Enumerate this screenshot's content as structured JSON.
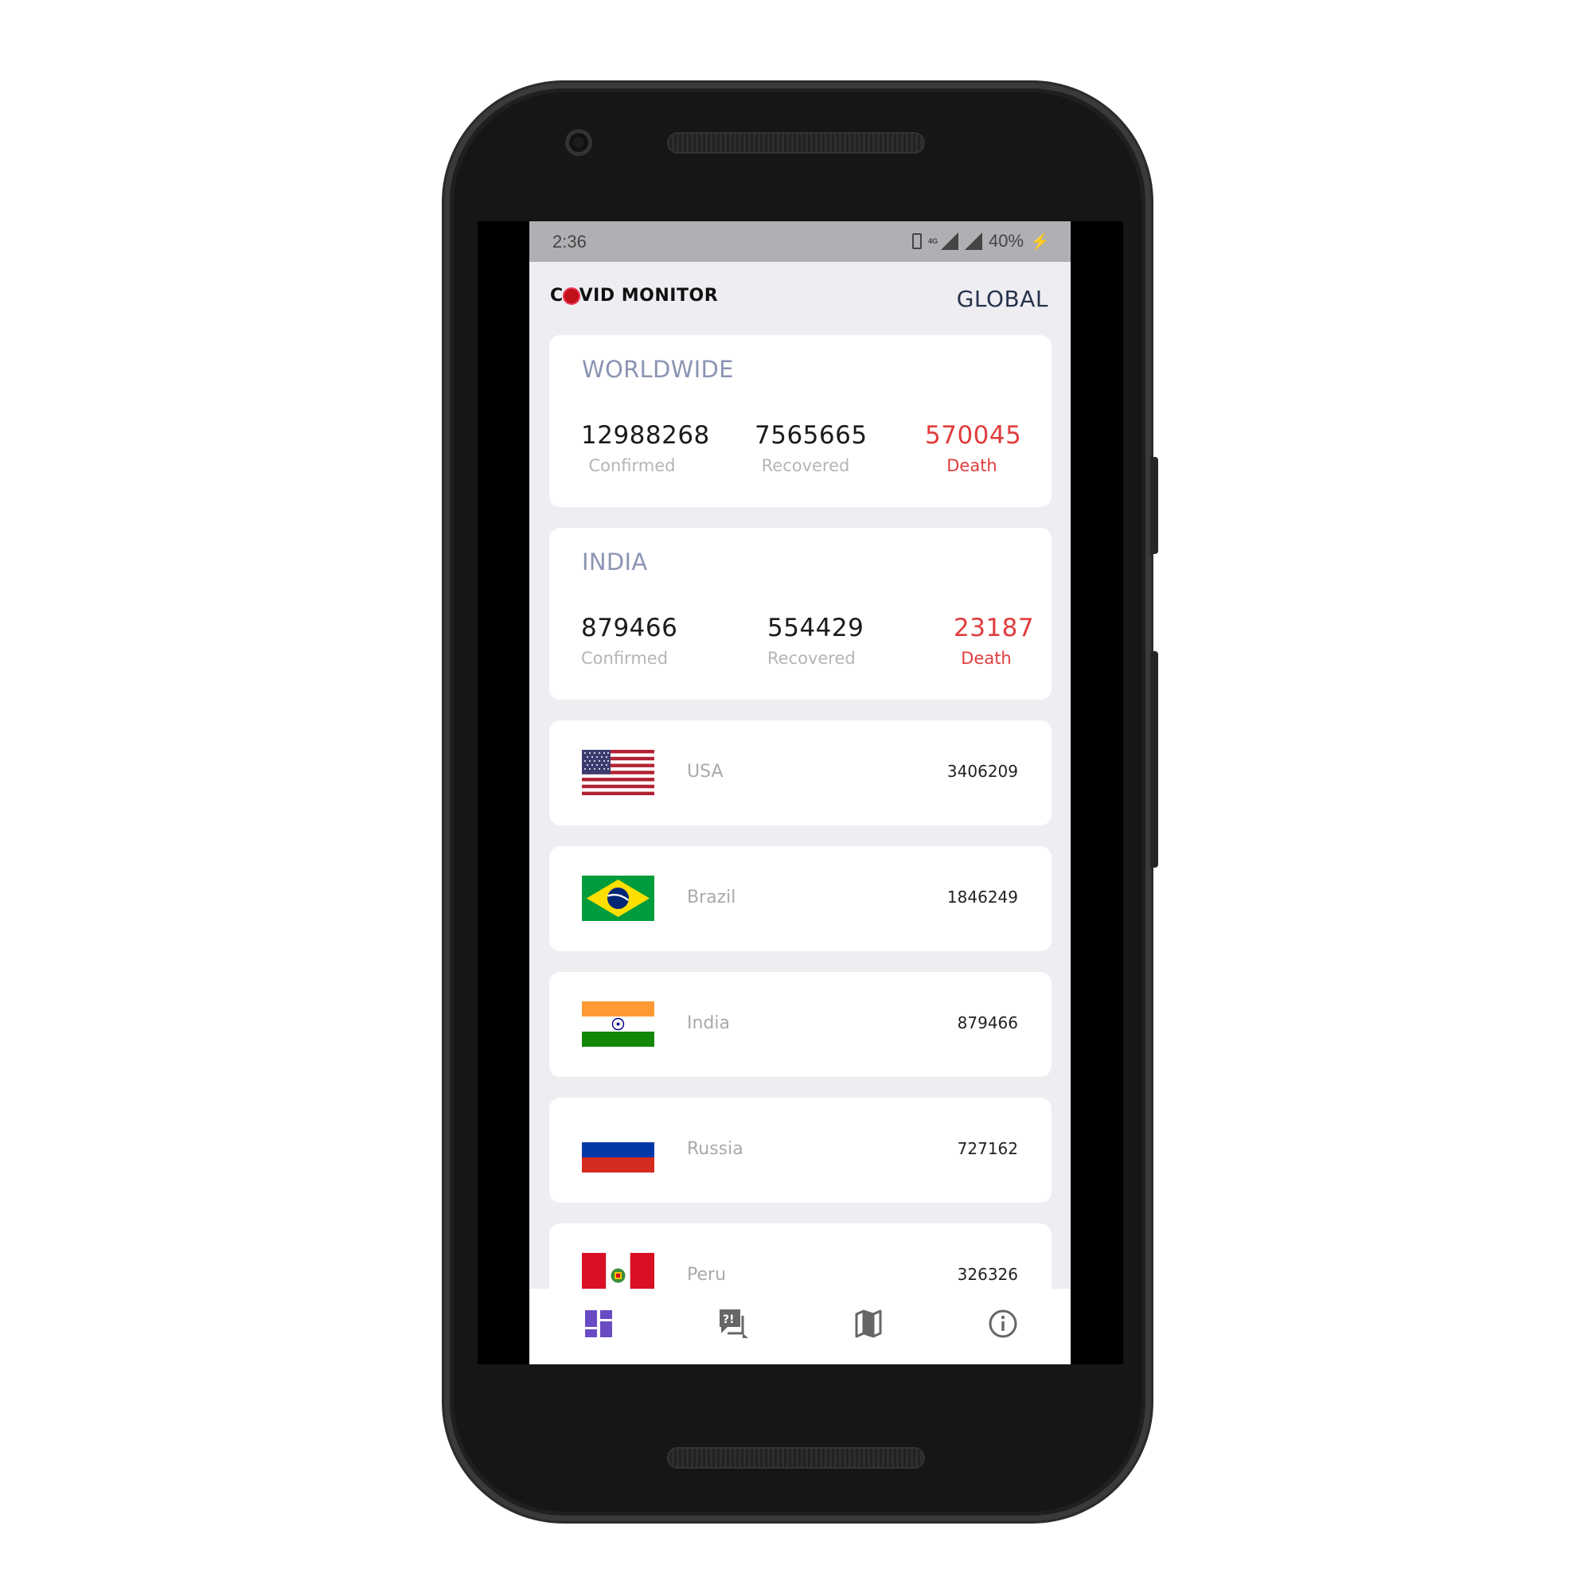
{
  "status_bar": {
    "time": "2:36",
    "network": "4G",
    "battery": "40%"
  },
  "header": {
    "logo_text_start": "C",
    "logo_text_end": "VID MONITOR",
    "title": "GLOBAL"
  },
  "worldwide": {
    "title": "WORLDWIDE",
    "confirmed": "12988268",
    "confirmed_label": "Confirmed",
    "recovered": "7565665",
    "recovered_label": "Recovered",
    "death": "570045",
    "death_label": "Death"
  },
  "india_summary": {
    "title": "INDIA",
    "confirmed": "879466",
    "confirmed_label": "Confirmed",
    "recovered": "554429",
    "recovered_label": "Recovered",
    "death": "23187",
    "death_label": "Death"
  },
  "countries": [
    {
      "name": "USA",
      "value": "3406209",
      "flag": "usa-flag"
    },
    {
      "name": "Brazil",
      "value": "1846249",
      "flag": "brazil-flag"
    },
    {
      "name": "India",
      "value": "879466",
      "flag": "india-flag"
    },
    {
      "name": "Russia",
      "value": "727162",
      "flag": "russia-flag"
    },
    {
      "name": "Peru",
      "value": "326326",
      "flag": "peru-flag"
    }
  ],
  "nav": [
    {
      "icon": "dashboard-icon",
      "active": true
    },
    {
      "icon": "faq-icon",
      "active": false
    },
    {
      "icon": "map-icon",
      "active": false
    },
    {
      "icon": "info-icon",
      "active": false
    }
  ],
  "colors": {
    "death": "#e03d3d",
    "accent": "#6a4bc4",
    "title": "#27324d",
    "card_title": "#8b95b3"
  }
}
